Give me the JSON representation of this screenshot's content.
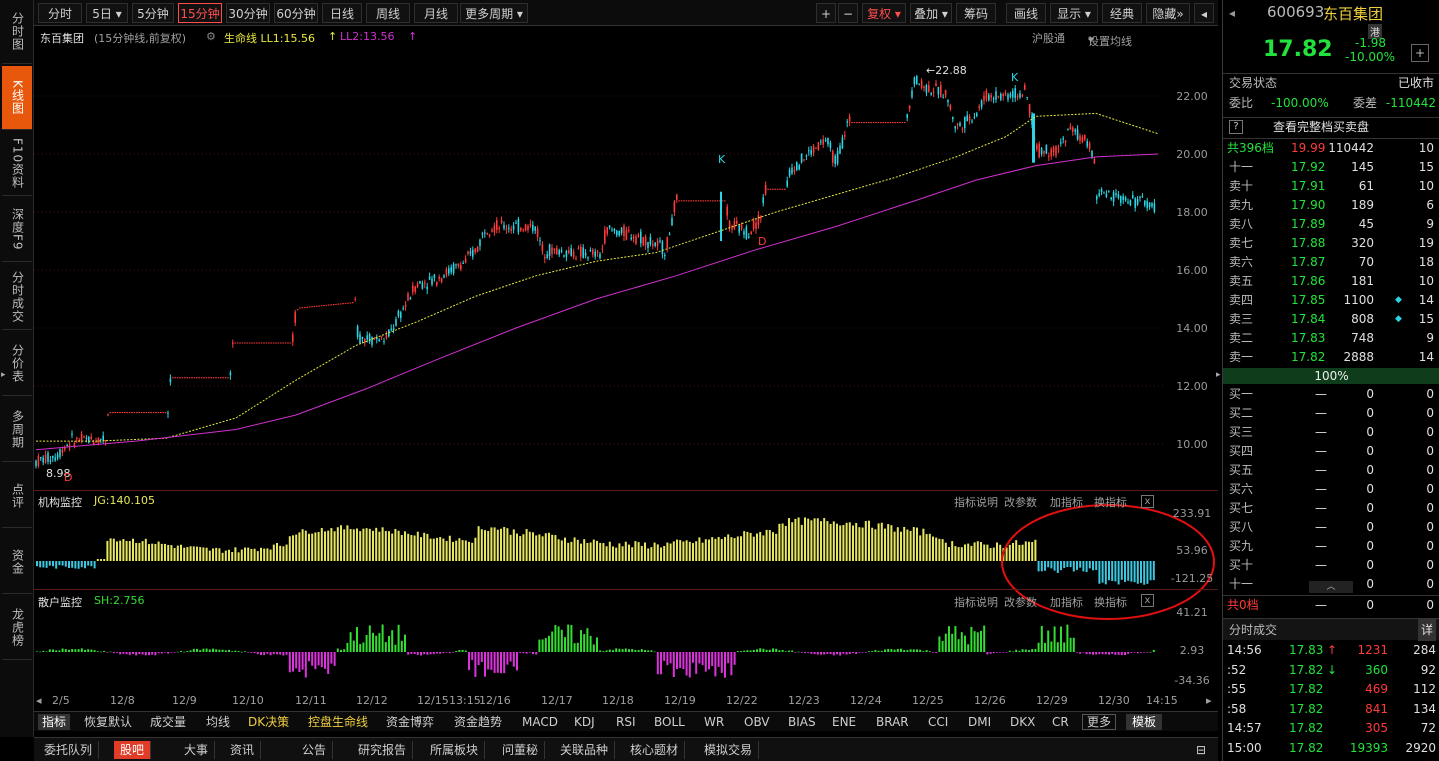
{
  "left_nav": [
    {
      "label": "分时图",
      "active": false
    },
    {
      "label": "K线图",
      "active": true
    },
    {
      "label": "F10资料",
      "active": false
    },
    {
      "label": "深度F9",
      "active": false
    },
    {
      "label": "分时成交",
      "active": false
    },
    {
      "label": "分价表",
      "active": false
    },
    {
      "label": "多周期",
      "active": false
    },
    {
      "label": "点评",
      "active": false
    },
    {
      "label": "资金",
      "active": false
    },
    {
      "label": "龙虎榜",
      "active": false
    }
  ],
  "toolbar": {
    "periods": [
      "分时",
      "5日",
      "5分钟",
      "15分钟",
      "30分钟",
      "60分钟",
      "日线",
      "周线",
      "月线",
      "更多周期"
    ],
    "right": [
      "+",
      "−",
      "复权",
      "叠加",
      "筹码",
      "画线",
      "显示",
      "经典",
      "隐藏"
    ]
  },
  "subheader": {
    "stock": "东百集团",
    "mode": "(15分钟线,前复权)",
    "ll1": "生命线 LL1:15.56",
    "ll2": "LL2:13.56",
    "hgt": "沪股通",
    "ma_set": "设置均线"
  },
  "price_axis": [
    "22.00",
    "20.00",
    "18.00",
    "16.00",
    "14.00",
    "12.00",
    "10.00"
  ],
  "price_annotations": {
    "high": "22.88",
    "low": "8.98",
    "k": "K",
    "d": "D"
  },
  "indicator1": {
    "title": "机构监控",
    "value": "JG:140.105",
    "axis": [
      "233.91",
      "53.96",
      "-121.25"
    ],
    "links": [
      "指标说明",
      "改参数",
      "加指标",
      "换指标"
    ],
    "close": "x"
  },
  "indicator2": {
    "title": "散户监控",
    "value": "SH:2.756",
    "axis": [
      "41.21",
      "2.93",
      "-34.36"
    ],
    "links": [
      "指标说明",
      "改参数",
      "加指标",
      "换指标"
    ],
    "close": "x"
  },
  "dates": [
    "2/5",
    "12/8",
    "12/9",
    "12/10",
    "12/11",
    "12/12",
    "12/15",
    "13:15",
    "12/16",
    "12/17",
    "12/18",
    "12/19",
    "12/22",
    "12/23",
    "12/24",
    "12/25",
    "12/26",
    "12/29",
    "12/30",
    "14:15"
  ],
  "bottom_tabs": [
    "指标",
    "恢复默认",
    "成交量",
    "均线",
    "DK决策",
    "控盘生命线",
    "资金博弈",
    "资金趋势",
    "MACD",
    "KDJ",
    "RSI",
    "BOLL",
    "WR",
    "OBV",
    "BIAS",
    "ENE",
    "BRAR",
    "CCI",
    "DMI",
    "DKX",
    "CR",
    "更多",
    "模板"
  ],
  "footer_tabs": [
    "委托队列",
    "股吧",
    "大事",
    "资讯",
    "公告",
    "研究报告",
    "所属板块",
    "问董秘",
    "关联品种",
    "核心题材",
    "模拟交易"
  ],
  "quote": {
    "code": "600693",
    "name": "东百集团",
    "tag": "港",
    "price": "17.82",
    "change": "-1.98",
    "pct": "-10.00%",
    "trade_status_label": "交易状态",
    "trade_status": "已收市",
    "wb_label": "委比",
    "wb": "-100.00%",
    "wc_label": "委差",
    "wc": "-110442",
    "full_book": "查看完整档买卖盘",
    "total_label": "共396档",
    "total_price": "19.99",
    "total_vol": "110442",
    "total_cnt": "10",
    "asks": [
      {
        "l": "十一",
        "p": "17.92",
        "v": "145",
        "c": "15"
      },
      {
        "l": "卖十",
        "p": "17.91",
        "v": "61",
        "c": "10"
      },
      {
        "l": "卖九",
        "p": "17.90",
        "v": "189",
        "c": "6"
      },
      {
        "l": "卖八",
        "p": "17.89",
        "v": "45",
        "c": "9"
      },
      {
        "l": "卖七",
        "p": "17.88",
        "v": "320",
        "c": "19"
      },
      {
        "l": "卖六",
        "p": "17.87",
        "v": "70",
        "c": "18"
      },
      {
        "l": "卖五",
        "p": "17.86",
        "v": "181",
        "c": "10"
      },
      {
        "l": "卖四",
        "p": "17.85",
        "v": "1100",
        "c": "14"
      },
      {
        "l": "卖三",
        "p": "17.84",
        "v": "808",
        "c": "15"
      },
      {
        "l": "卖二",
        "p": "17.83",
        "v": "748",
        "c": "9"
      },
      {
        "l": "卖一",
        "p": "17.82",
        "v": "2888",
        "c": "14"
      }
    ],
    "pct_bar": "100%",
    "bids": [
      {
        "l": "买一",
        "p": "—",
        "v": "0",
        "c": "0"
      },
      {
        "l": "买二",
        "p": "—",
        "v": "0",
        "c": "0"
      },
      {
        "l": "买三",
        "p": "—",
        "v": "0",
        "c": "0"
      },
      {
        "l": "买四",
        "p": "—",
        "v": "0",
        "c": "0"
      },
      {
        "l": "买五",
        "p": "—",
        "v": "0",
        "c": "0"
      },
      {
        "l": "买六",
        "p": "—",
        "v": "0",
        "c": "0"
      },
      {
        "l": "买七",
        "p": "—",
        "v": "0",
        "c": "0"
      },
      {
        "l": "买八",
        "p": "—",
        "v": "0",
        "c": "0"
      },
      {
        "l": "买九",
        "p": "—",
        "v": "0",
        "c": "0"
      },
      {
        "l": "买十",
        "p": "—",
        "v": "0",
        "c": "0"
      },
      {
        "l": "十一",
        "p": "—",
        "v": "0",
        "c": "0"
      }
    ],
    "total_b_label": "共0档",
    "total_b_price": "—",
    "total_b_vol": "0",
    "total_b_cnt": "0",
    "ticks_title": "分时成交",
    "ticks_detail": "详",
    "ticks": [
      {
        "t": "14:56",
        "p": "17.83",
        "v": "1231",
        "n": "284",
        "arrow": "↑"
      },
      {
        "t": ":52",
        "p": "17.82",
        "v": "360",
        "n": "92",
        "arrow": "↓"
      },
      {
        "t": ":55",
        "p": "17.82",
        "v": "469",
        "n": "112",
        "arrow": ""
      },
      {
        "t": ":58",
        "p": "17.82",
        "v": "841",
        "n": "134",
        "arrow": ""
      },
      {
        "t": "14:57",
        "p": "17.82",
        "v": "305",
        "n": "72",
        "arrow": ""
      },
      {
        "t": "15:00",
        "p": "17.82",
        "v": "19393",
        "n": "2920",
        "arrow": ""
      }
    ]
  },
  "colors": {
    "up": "#ff3b3b",
    "down": "#2ad6e6",
    "ll1": "#e8e840",
    "ll2": "#d030d0",
    "inst_pos": "#e8e860",
    "inst_neg": "#3cc8e0",
    "retail_pos": "#33dd33",
    "retail_neg": "#dd33dd"
  }
}
